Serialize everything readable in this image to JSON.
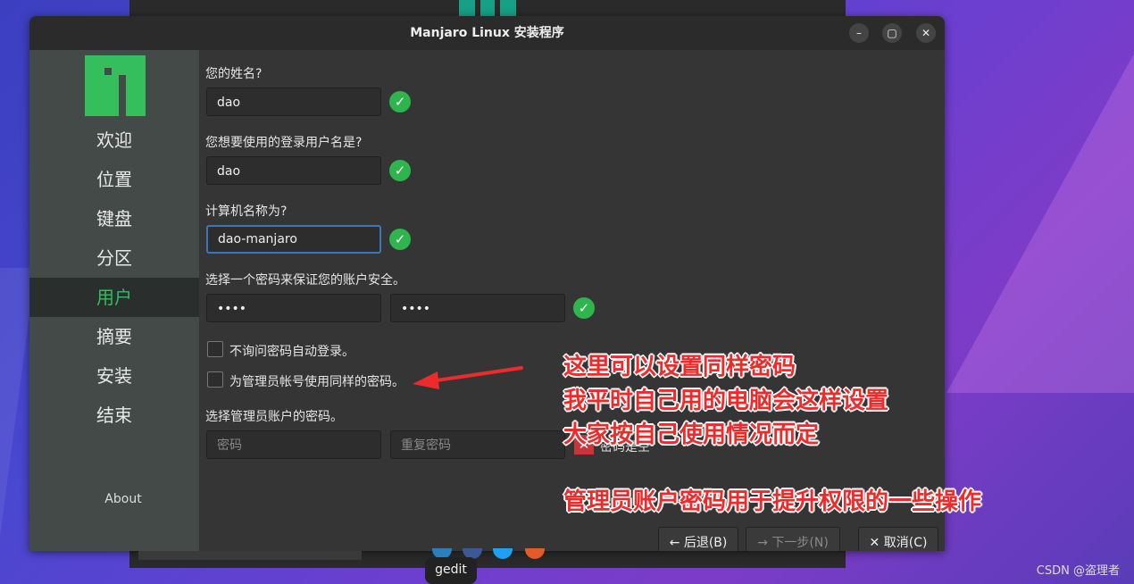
{
  "window": {
    "title": "Manjaro Linux 安装程序"
  },
  "window_buttons": {
    "minimize": "–",
    "maximize": "▢",
    "close": "✕"
  },
  "sidebar": {
    "items": [
      {
        "label": "欢迎"
      },
      {
        "label": "位置"
      },
      {
        "label": "键盘"
      },
      {
        "label": "分区"
      },
      {
        "label": "用户",
        "active": true
      },
      {
        "label": "摘要"
      },
      {
        "label": "安装"
      },
      {
        "label": "结束"
      }
    ],
    "about": "About"
  },
  "form": {
    "name_label": "您的姓名?",
    "name_value": "dao",
    "username_label": "您想要使用的登录用户名是?",
    "username_value": "dao",
    "hostname_label": "计算机名称为?",
    "hostname_value": "dao-manjaro",
    "password_label": "选择一个密码来保证您的账户安全。",
    "password_value": "••••",
    "password_repeat_value": "••••",
    "autologin_label": "不询问密码自动登录。",
    "same_password_label": "为管理员帐号使用同样的密码。",
    "admin_password_label": "选择管理员账户的密码。",
    "admin_password_placeholder": "密码",
    "admin_password_repeat_placeholder": "重复密码",
    "admin_password_status": "密码是空"
  },
  "buttons": {
    "back": "后退(B)",
    "next": "下一步(N)",
    "cancel": "取消(C)"
  },
  "annotations": {
    "line1": "这里可以设置同样密码",
    "line2": "我平时自己用的电脑会这样设置",
    "line3": "大家按自己使用情况而定",
    "line4": "管理员账户密码用于提升权限的一些操作"
  },
  "dock": {
    "label": "gedit"
  },
  "watermark": "CSDN @盗理者",
  "colors": {
    "accent": "#35bf5c",
    "check": "#2fb54d",
    "error": "#c8353a",
    "annotation": "#ee2b2b",
    "focus": "#3d76b8"
  }
}
